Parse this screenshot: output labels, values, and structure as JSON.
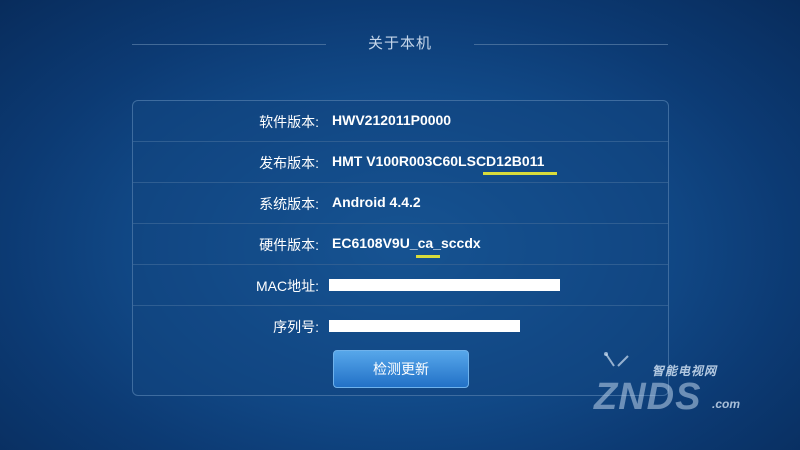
{
  "header": {
    "title": "关于本机"
  },
  "info_rows": [
    {
      "label": "软件版本:",
      "value": "HWV212011P0000"
    },
    {
      "label": "发布版本:",
      "value": "HMT V100R003C60LSCD12B011"
    },
    {
      "label": "系统版本:",
      "value": "Android 4.4.2"
    },
    {
      "label": "硬件版本:",
      "value": "EC6108V9U_ca_sccdx"
    },
    {
      "label": "MAC地址:",
      "value": ""
    },
    {
      "label": "序列号:",
      "value": ""
    }
  ],
  "update_button": {
    "label": "检测更新"
  },
  "watermark": {
    "site_cn": "智能电视网",
    "brand": "ZNDS",
    "domain": ".com"
  },
  "colors": {
    "background": "#134f8f",
    "button": "#3a8ee0",
    "highlight_underline": "#d8dc3c"
  }
}
